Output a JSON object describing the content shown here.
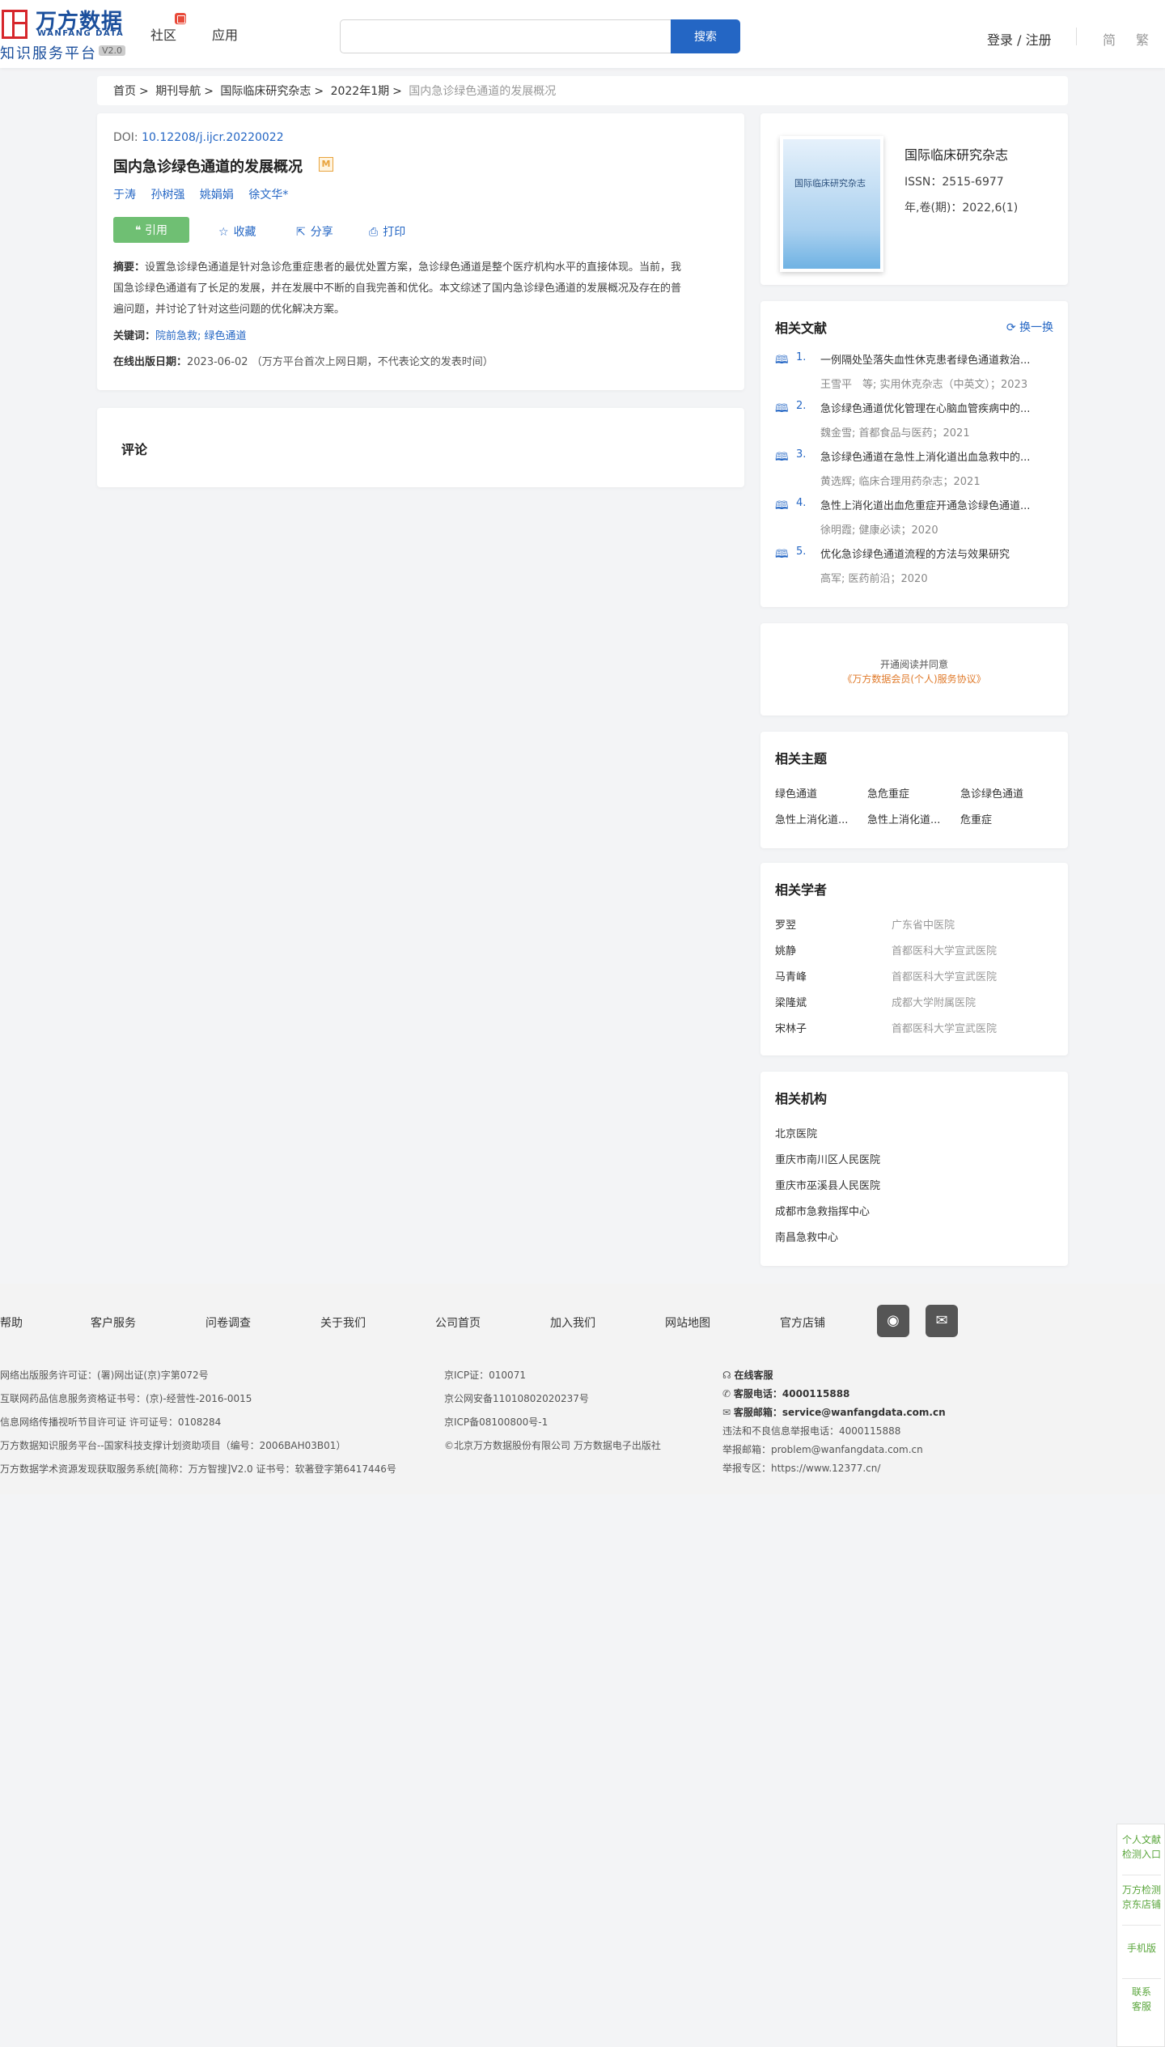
{
  "header": {
    "logo_cn": "万方数据",
    "logo_en": "WANFANG DATA",
    "logo_sub": "知识服务平台",
    "logo_version": "V2.0",
    "nav": [
      "社区",
      "应用"
    ],
    "search_placeholder": "",
    "search_button": "搜索",
    "login": "登录 / 注册",
    "lang_simplified": "简",
    "lang_traditional": "繁"
  },
  "breadcrumb": [
    "首页",
    "期刊导航",
    "国际临床研究杂志",
    "2022年1期",
    "国内急诊绿色通道的发展概况"
  ],
  "breadcrumb_sep": ">",
  "article": {
    "doi_label": "DOI:",
    "doi": "10.12208/j.ijcr.20220022",
    "title": "国内急诊绿色通道的发展概况",
    "badge": "M",
    "authors": [
      "于涛",
      "孙树强",
      "姚娟娟",
      "徐文华*"
    ],
    "cite": "引用",
    "actions": [
      "收藏",
      "分享",
      "打印"
    ],
    "abstract_label": "摘要：",
    "abstract_line1": "设置急诊绿色通道是针对急诊危重症患者的最优处置方案，急诊绿色通道是整个医疗机构水平的直接体现。当前，我",
    "abstract_line2": "国急诊绿色通道有了长足的发展，并在发展中不断的自我完善和优化。本文综述了国内急诊绿色通道的发展概况及存在的普",
    "abstract_line3": "遍问题，并讨论了针对这些问题的优化解决方案。",
    "keywords_label": "关键词：",
    "keywords": "院前急救; 绿色通道",
    "pubdate_label": "在线出版日期：",
    "pubdate": "2023-06-02",
    "pubdate_note": "（万方平台首次上网日期，不代表论文的发表时间）"
  },
  "comment": {
    "title": "评论"
  },
  "journal": {
    "cover_text": "国际临床研究杂志",
    "name": "国际临床研究杂志",
    "issn": "ISSN：2515-6977",
    "issue": "年,卷(期)：2022,6(1)"
  },
  "related_docs": {
    "title": "相关文献",
    "refresh": "换一换",
    "items": [
      {
        "num": "1.",
        "title": "一例隔处坠落失血性休克患者绿色通道救治...",
        "meta": "王雪平　等; 实用休克杂志（中英文）；2023"
      },
      {
        "num": "2.",
        "title": "急诊绿色通道优化管理在心脑血管疾病中的...",
        "meta": "魏金雪; 首都食品与医药；2021"
      },
      {
        "num": "3.",
        "title": "急诊绿色通道在急性上消化道出血急救中的...",
        "meta": "黄选辉; 临床合理用药杂志；2021"
      },
      {
        "num": "4.",
        "title": "急性上消化道出血危重症开通急诊绿色通道...",
        "meta": "徐明霞; 健康必读；2020"
      },
      {
        "num": "5.",
        "title": "优化急诊绿色通道流程的方法与效果研究",
        "meta": "高军; 医药前沿；2020"
      }
    ]
  },
  "agreement": {
    "line1": "开通阅读并同意",
    "line2": "《万方数据会员(个人)服务协议》"
  },
  "topics": {
    "title": "相关主题",
    "items": [
      "绿色通道",
      "急危重症",
      "急诊绿色通道",
      "急性上消化道...",
      "急性上消化道...",
      "危重症"
    ]
  },
  "scholars": {
    "title": "相关学者",
    "items": [
      {
        "name": "罗翌",
        "org": "广东省中医院"
      },
      {
        "name": "姚静",
        "org": "首都医科大学宣武医院"
      },
      {
        "name": "马青峰",
        "org": "首都医科大学宣武医院"
      },
      {
        "name": "梁隆斌",
        "org": "成都大学附属医院"
      },
      {
        "name": "宋林子",
        "org": "首都医科大学宣武医院"
      }
    ]
  },
  "institutions": {
    "title": "相关机构",
    "items": [
      "北京医院",
      "重庆市南川区人民医院",
      "重庆市巫溪县人民医院",
      "成都市急救指挥中心",
      "南昌急救中心"
    ]
  },
  "footer": {
    "links": [
      "帮助",
      "客户服务",
      "问卷调查",
      "关于我们",
      "公司首页",
      "加入我们",
      "网站地图",
      "官方店铺"
    ],
    "col1": [
      "网络出版服务许可证：(署)网出证(京)字第072号",
      "互联网药品信息服务资格证书号：(京)-经营性-2016-0015",
      "信息网络传播视听节目许可证 许可证号：0108284",
      "万方数据知识服务平台--国家科技支撑计划资助项目（编号：2006BAH03B01）",
      "万方数据学术资源发现获取服务系统[简称：万方智搜]V2.0 证书号：软著登字第6417446号"
    ],
    "col2": [
      "京ICP证：010071",
      "京公网安备11010802020237号",
      "京ICP备08100800号-1",
      "©北京万方数据股份有限公司 万方数据电子出版社"
    ],
    "service_label": "在线客服",
    "phone_label": "客服电话：",
    "phone": "4000115888",
    "email_label": "客服邮箱：",
    "email": "service@wanfangdata.com.cn",
    "report_phone": "违法和不良信息举报电话：4000115888",
    "report_email": "举报邮箱：problem@wanfangdata.com.cn",
    "report_site": "举报专区：https://www.12377.cn/"
  },
  "float_buttons": [
    [
      "个人文献",
      "检测入口"
    ],
    [
      "万方检测",
      "京东店铺"
    ],
    [
      "手机版"
    ],
    [
      "联系",
      "客服"
    ]
  ]
}
